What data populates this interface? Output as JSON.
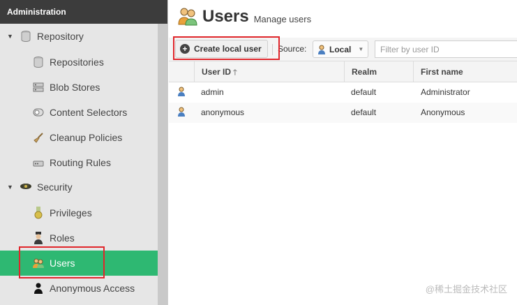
{
  "sidebar": {
    "header": "Administration",
    "groups": [
      {
        "label": "Repository",
        "icon": "database-icon"
      },
      {
        "label": "Security",
        "icon": "security-badge-icon"
      }
    ],
    "repository_items": [
      {
        "label": "Repositories",
        "icon": "database-icon"
      },
      {
        "label": "Blob Stores",
        "icon": "server-icon"
      },
      {
        "label": "Content Selectors",
        "icon": "selector-icon"
      },
      {
        "label": "Cleanup Policies",
        "icon": "broom-icon"
      },
      {
        "label": "Routing Rules",
        "icon": "router-icon"
      }
    ],
    "security_items": [
      {
        "label": "Privileges",
        "icon": "medal-icon"
      },
      {
        "label": "Roles",
        "icon": "role-icon"
      },
      {
        "label": "Users",
        "icon": "users-icon",
        "selected": true
      },
      {
        "label": "Anonymous Access",
        "icon": "person-icon"
      }
    ]
  },
  "main": {
    "title": "Users",
    "subtitle": "Manage users",
    "toolbar": {
      "create_label": "Create local user",
      "source_label": "Source:",
      "source_value": "Local",
      "filter_placeholder": "Filter by user ID"
    },
    "table": {
      "columns": [
        "User ID",
        "Realm",
        "First name"
      ],
      "rows": [
        {
          "user_id": "admin",
          "realm": "default",
          "first_name": "Administrator"
        },
        {
          "user_id": "anonymous",
          "realm": "default",
          "first_name": "Anonymous"
        }
      ]
    }
  },
  "watermark": "@稀土掘金技术社区",
  "colors": {
    "selected": "#2eb872",
    "header_bg": "#3c3c3c",
    "highlight": "#e0262b"
  }
}
